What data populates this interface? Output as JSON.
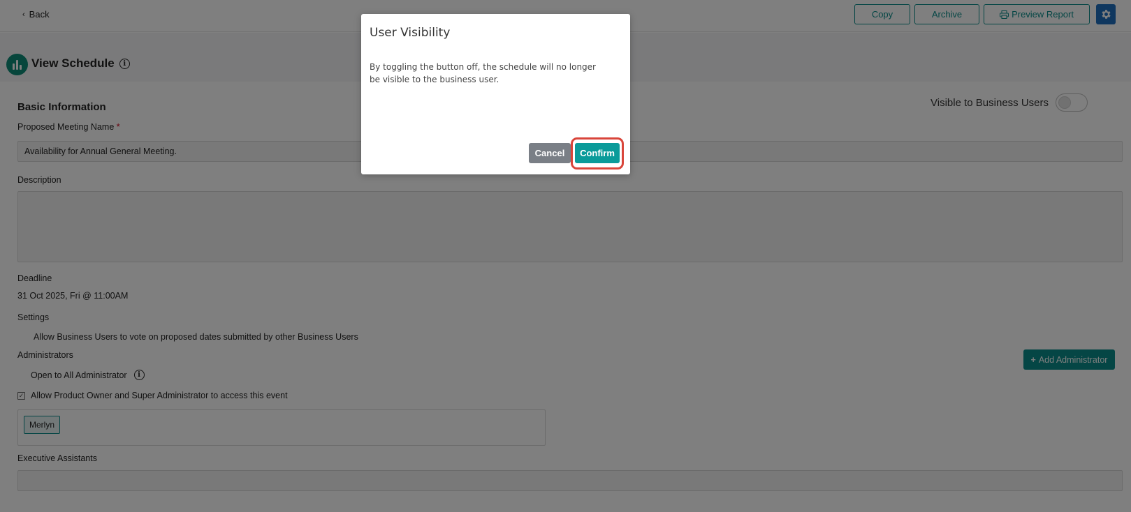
{
  "topbar": {
    "back_label": "Back",
    "copy_label": "Copy",
    "archive_label": "Archive",
    "preview_label": "Preview Report",
    "icons": {
      "back": "chevron-left-icon",
      "preview": "printer-icon",
      "settings": "gear-icon"
    }
  },
  "header": {
    "title": "View Schedule"
  },
  "basic_info": {
    "section_title": "Basic Information",
    "visible_toggle_label": "Visible to Business Users",
    "visible_toggle_state": "off",
    "meeting_name_label": "Proposed Meeting Name",
    "required_mark": "*",
    "meeting_name_value": "Availability for Annual General Meeting.",
    "description_label": "Description",
    "description_value": "",
    "deadline_label": "Deadline",
    "deadline_value": "31 Oct 2025, Fri @ 11:00AM",
    "settings_label": "Settings",
    "settings_option": "Allow Business Users to vote on proposed dates submitted by other Business Users",
    "administrators_label": "Administrators",
    "add_admin_label": "Add Administrator",
    "open_all_admin_label": "Open to All Administrator",
    "allow_owner_label": "Allow Product Owner and Super Administrator to access this event",
    "admin_chips": [
      "Merlyn"
    ],
    "exec_assistants_label": "Executive Assistants"
  },
  "modal": {
    "title": "User Visibility",
    "body": "By toggling the button off, the schedule will no longer be visible to the business user.",
    "cancel_label": "Cancel",
    "confirm_label": "Confirm"
  },
  "colors": {
    "accent": "#0a8d8a",
    "settings_blue": "#1f6fbf",
    "highlight_ring": "#d9453a",
    "overlay": "rgba(0,0,0,0.5)"
  }
}
